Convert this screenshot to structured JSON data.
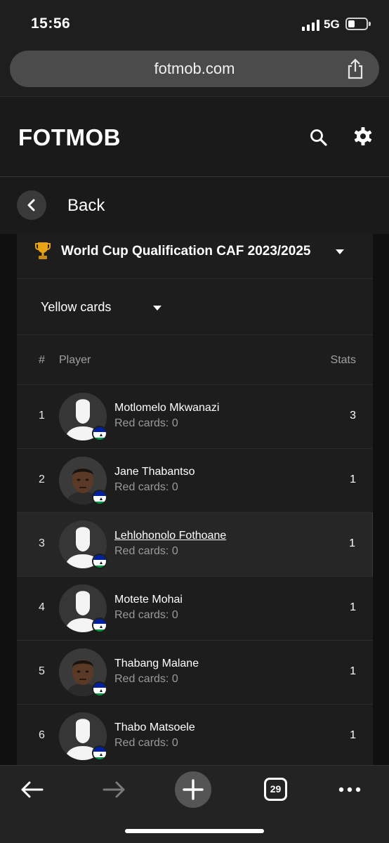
{
  "status": {
    "time": "15:56",
    "network": "5G"
  },
  "browser": {
    "url": "fotmob.com",
    "tab_count": "29"
  },
  "app": {
    "logo": "FOTMOB"
  },
  "nav": {
    "back_label": "Back"
  },
  "league": {
    "name": "World Cup Qualification CAF 2023/2025",
    "icon": "trophy-icon"
  },
  "stat_selector": {
    "selected": "Yellow cards"
  },
  "table": {
    "headers": {
      "rank": "#",
      "player": "Player",
      "stats": "Stats"
    },
    "rows": [
      {
        "rank": "1",
        "name": "Motlomelo Mkwanazi",
        "sub": "Red cards: 0",
        "stat": "3",
        "photo": "placeholder"
      },
      {
        "rank": "2",
        "name": "Jane Thabantso",
        "sub": "Red cards: 0",
        "stat": "1",
        "photo": "face"
      },
      {
        "rank": "3",
        "name": "Lehlohonolo Fothoane",
        "sub": "Red cards: 0",
        "stat": "1",
        "photo": "placeholder"
      },
      {
        "rank": "4",
        "name": "Motete Mohai",
        "sub": "Red cards: 0",
        "stat": "1",
        "photo": "placeholder"
      },
      {
        "rank": "5",
        "name": "Thabang Malane",
        "sub": "Red cards: 0",
        "stat": "1",
        "photo": "face"
      },
      {
        "rank": "6",
        "name": "Thabo Matsoele",
        "sub": "Red cards: 0",
        "stat": "1",
        "photo": "placeholder"
      }
    ]
  },
  "colors": {
    "background": "#1c1c1c",
    "card": "#1d1d1d",
    "trophy": "#e8a317",
    "flag_blue": "#00209f",
    "flag_green": "#009543"
  }
}
